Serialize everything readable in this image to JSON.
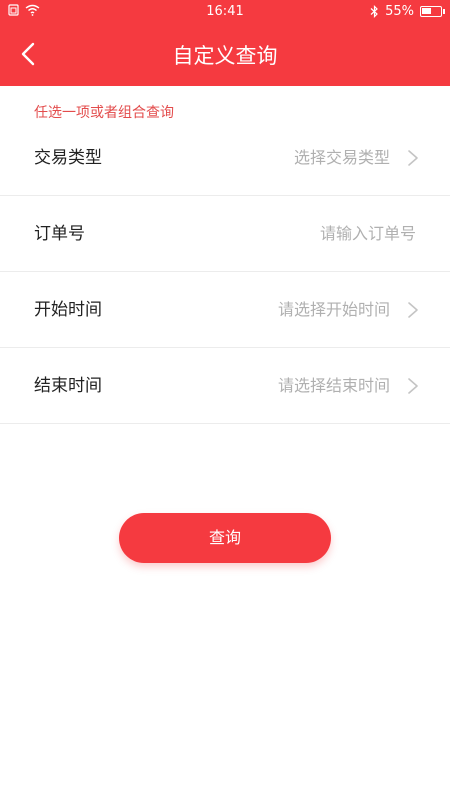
{
  "status_bar": {
    "time": "16:41",
    "battery_percent": "55%",
    "battery_level": 0.55
  },
  "header": {
    "title": "自定义查询",
    "back_icon": "chevron-left-icon",
    "background_color": "#f53a40"
  },
  "hint": "任选一项或者组合查询",
  "form": {
    "rows": [
      {
        "label": "交易类型",
        "placeholder": "选择交易类型",
        "has_arrow": true
      },
      {
        "label": "订单号",
        "placeholder": "请输入订单号",
        "has_arrow": false
      },
      {
        "label": "开始时间",
        "placeholder": "请选择开始时间",
        "has_arrow": true
      },
      {
        "label": "结束时间",
        "placeholder": "请选择结束时间",
        "has_arrow": true
      }
    ]
  },
  "query_button": {
    "label": "查询",
    "color": "#f53a40"
  }
}
